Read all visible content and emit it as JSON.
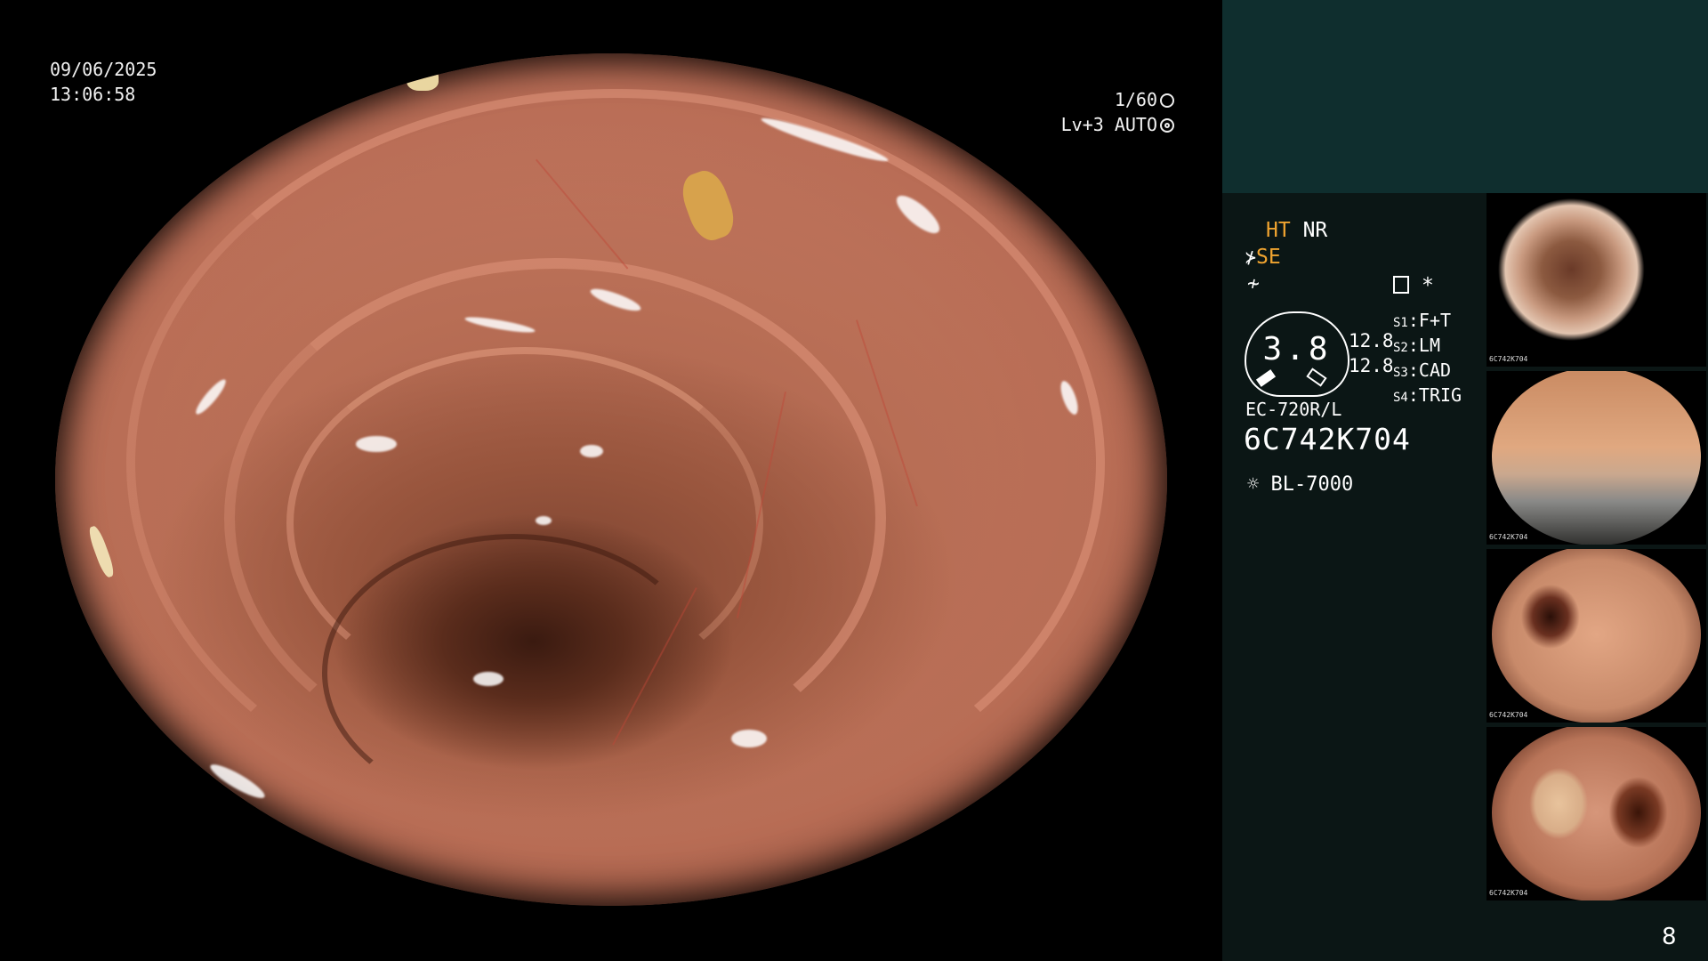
{
  "overlay": {
    "date": "09/06/2025",
    "time": "13:06:58",
    "shutter": "1/60",
    "shutter_icon": "aperture-icon",
    "iris": "Lv+3 AUTO",
    "iris_icon": "iris-icon"
  },
  "settings": {
    "ht": "HT",
    "nr": "NR",
    "se": "SE",
    "se_icon": "structure-enhance-icon",
    "color_icon": "color-enhance-icon",
    "memo_icon": "memo-card-icon",
    "asterisk": "*"
  },
  "gauge": {
    "value": "3.8",
    "right_top": "12.8",
    "right_bottom": "12.8"
  },
  "switches": [
    {
      "key": "S1",
      "value": "F+T"
    },
    {
      "key": "S2",
      "value": "LM"
    },
    {
      "key": "S3",
      "value": "CAD"
    },
    {
      "key": "S4",
      "value": "TRIG"
    }
  ],
  "scope": {
    "model": "EC-720R/L",
    "serial": "6C742K704",
    "light_icon": "light-source-icon",
    "light_source": "BL-7000"
  },
  "thumbnails": [
    {
      "id": "6C742K704"
    },
    {
      "id": "6C742K704"
    },
    {
      "id": "6C742K704"
    },
    {
      "id": "6C742K704"
    }
  ],
  "page_number": "8",
  "colors": {
    "amber": "#f0a430",
    "panel_top": "#0f2e2e",
    "panel": "#0b1615",
    "mucosa": "#cc826a"
  }
}
